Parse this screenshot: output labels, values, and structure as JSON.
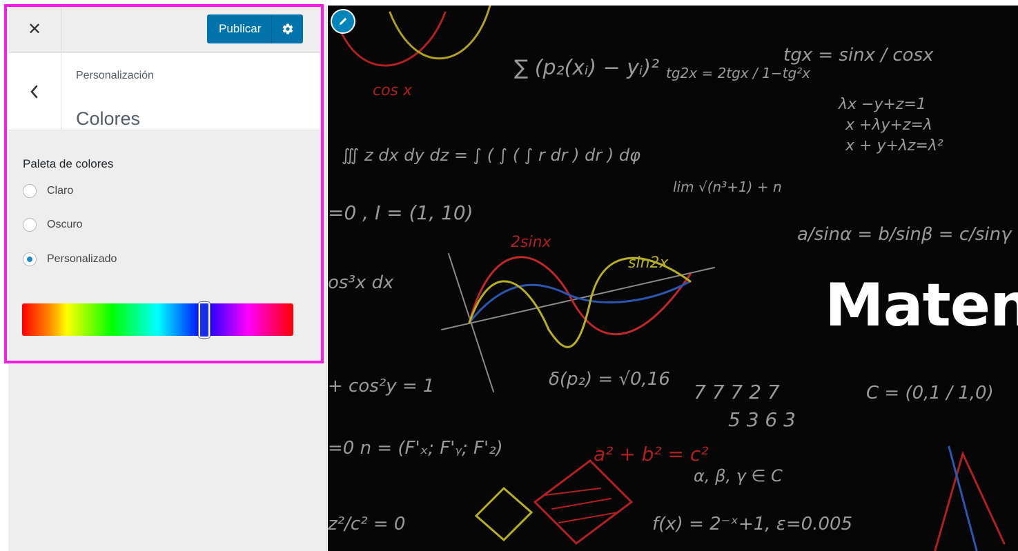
{
  "header": {
    "close_glyph": "✕",
    "publish_label": "Publicar"
  },
  "section": {
    "breadcrumb": "Personalización",
    "title": "Colores"
  },
  "control": {
    "label": "Paleta de colores",
    "options": [
      {
        "label": "Claro",
        "checked": false
      },
      {
        "label": "Oscuro",
        "checked": false
      },
      {
        "label": "Personalizado",
        "checked": true
      }
    ],
    "hue_value_fraction": 0.68
  },
  "preview": {
    "heading": "Maten"
  },
  "colors": {
    "accent": "#0073aa",
    "highlight": "#ff1ae8",
    "panel": "#eeeeee",
    "preview_bg": "#060606"
  },
  "icons": [
    "close-icon",
    "settings-gear-icon",
    "chevron-left-icon",
    "pencil-icon"
  ]
}
